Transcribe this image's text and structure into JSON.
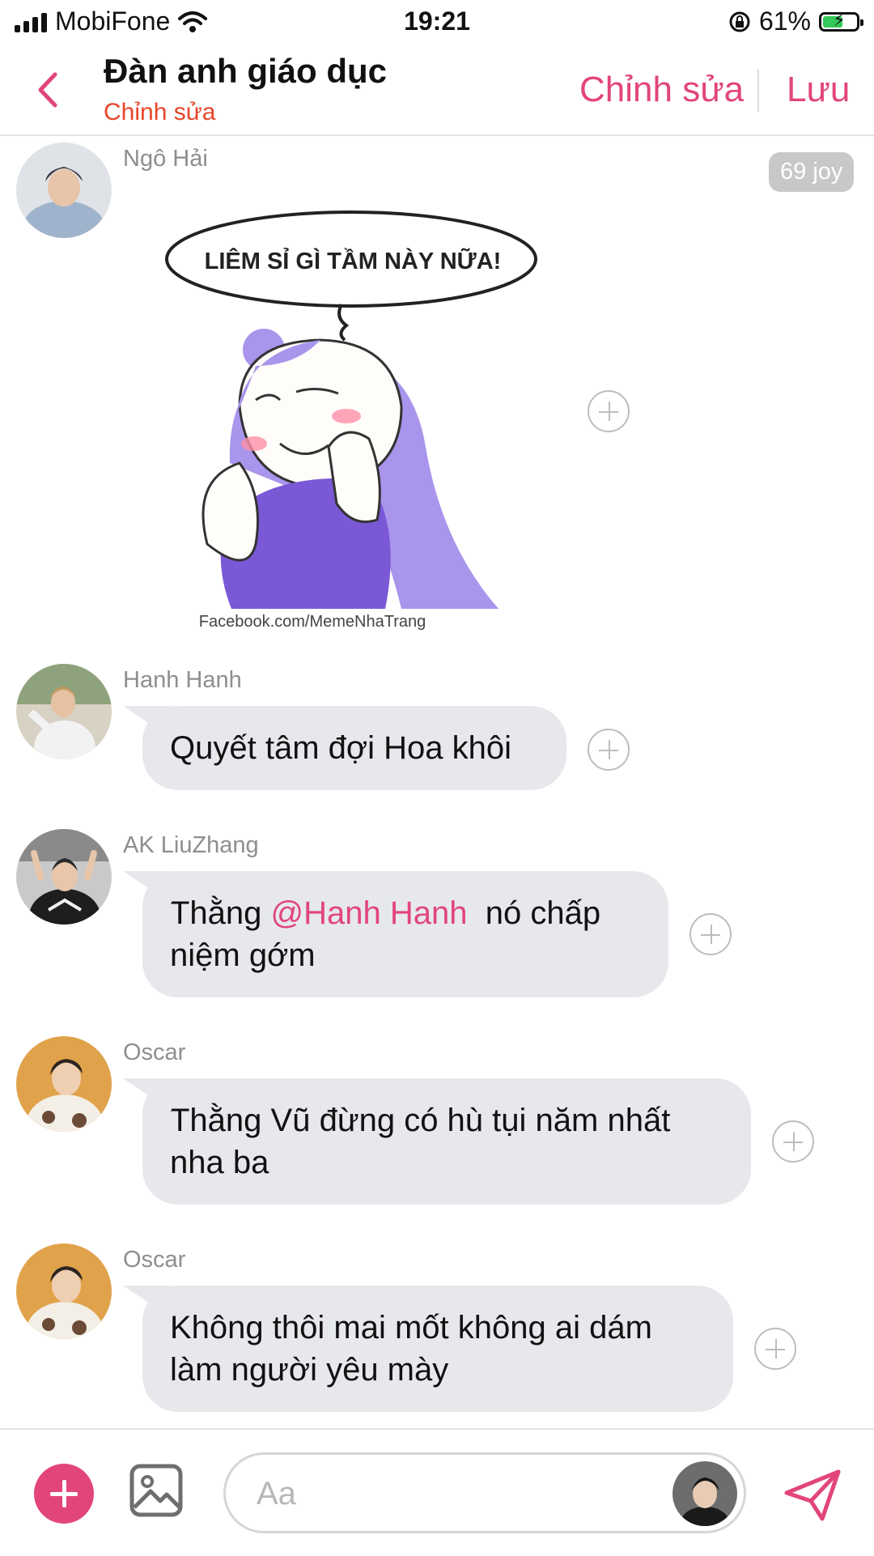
{
  "status_bar": {
    "carrier": "MobiFone",
    "time": "19:21",
    "battery": "61%",
    "battery_level": 0.61,
    "icons": [
      "signal-icon",
      "wifi-icon",
      "orientation-lock-icon",
      "battery-charging-icon"
    ]
  },
  "header": {
    "title": "Đàn anh giáo dục",
    "subtitle": "Chỉnh sửa",
    "edit_label": "Chỉnh sửa",
    "save_label": "Lưu",
    "accent": "#e2457c"
  },
  "messages": [
    {
      "sender": "Ngô Hải",
      "type": "sticker",
      "badge": "69 joy",
      "sticker_caption": "LIÊM SỈ GÌ TẦM NÀY NỮA!",
      "sticker_watermark": "Facebook.com/MemeNhaTrang"
    },
    {
      "sender": "Hanh Hanh",
      "text": "Quyết tâm đợi Hoa khôi"
    },
    {
      "sender": "AK LiuZhang",
      "text_before": "Thằng ",
      "mention": "@Hanh Hanh",
      "text_after": "  nó chấp niệm gớm"
    },
    {
      "sender": "Oscar",
      "text": "Thằng Vũ đừng có hù tụi năm nhất nha ba"
    },
    {
      "sender": "Oscar",
      "text": "Không thôi mai mốt không ai dám làm người yêu mày"
    }
  ],
  "composer": {
    "placeholder": "Aa"
  }
}
